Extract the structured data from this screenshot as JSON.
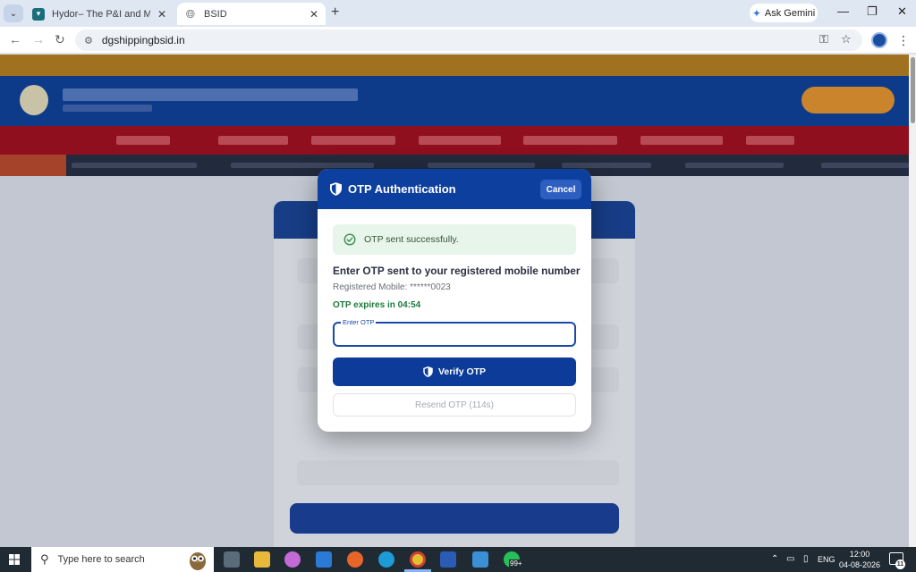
{
  "browser": {
    "tabs": [
      {
        "title": "Hydor– The P&I and Marine Lia",
        "active": false
      },
      {
        "title": "BSID",
        "active": true
      }
    ],
    "url": "dgshippingbsid.in",
    "gemini_label": "Ask Gemini",
    "new_tab_glyph": "+",
    "close_glyph": "✕",
    "minimize_glyph": "—",
    "maximize_glyph": "❐",
    "window_close_glyph": "✕"
  },
  "modal": {
    "title": "OTP Authentication",
    "cancel_label": "Cancel",
    "success_message": "OTP sent successfully.",
    "heading": "Enter OTP sent to your registered mobile number",
    "registered_mobile": "Registered Mobile: ******0023",
    "expiry": "OTP expires in 04:54",
    "otp_label": "Enter OTP",
    "otp_value": "",
    "verify_label": "Verify OTP",
    "resend_label": "Resend OTP (114s)"
  },
  "taskbar": {
    "search_placeholder": "Type here to search",
    "whatsapp_badge": "99+",
    "language": "ENG",
    "time": "12:00",
    "date": "04-08-2026",
    "notification_count": "11"
  },
  "colors": {
    "modal_header": "#0d3f9e",
    "verify_button": "#0c3b99",
    "success_bg": "#e8f5ea",
    "expiry_text": "#1d7a3c"
  }
}
